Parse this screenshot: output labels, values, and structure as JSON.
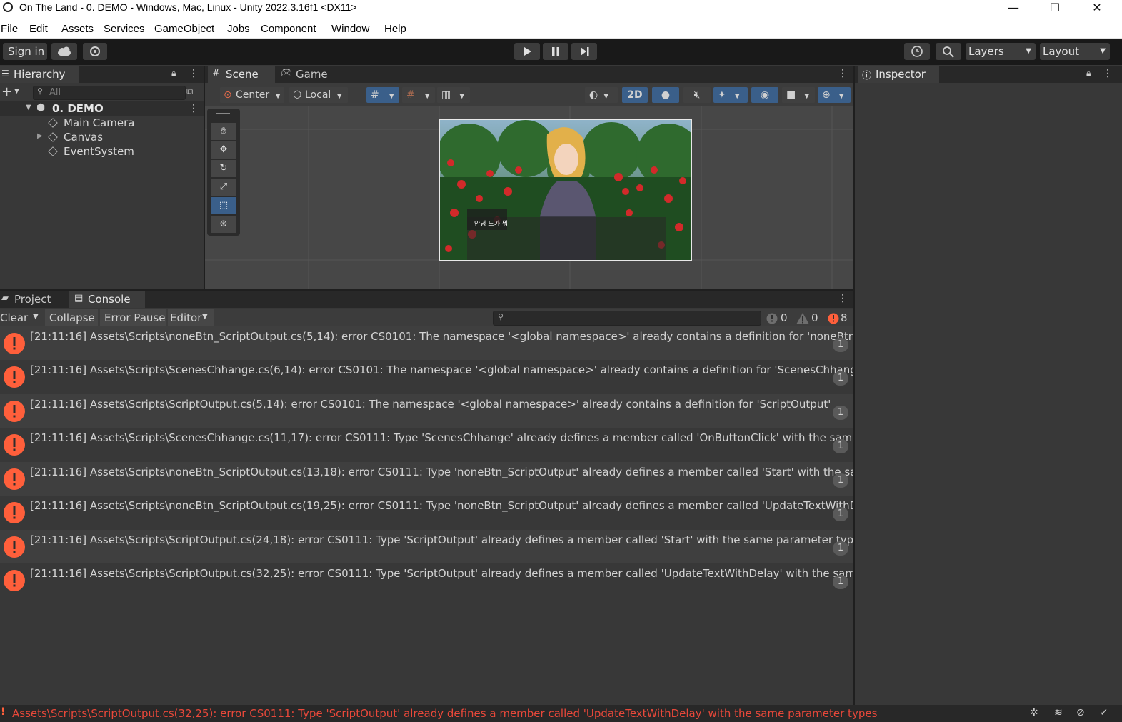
{
  "window": {
    "title": "On The Land - 0. DEMO - Windows, Mac, Linux - Unity 2022.3.16f1 <DX11>",
    "minimize": "—",
    "maximize": "☐",
    "close": "✕"
  },
  "menu": [
    "File",
    "Edit",
    "Assets",
    "Services",
    "GameObject",
    "Jobs",
    "Component",
    "Window",
    "Help"
  ],
  "toolbar": {
    "sign_in": "Sign in",
    "layers": "Layers",
    "layout": "Layout"
  },
  "hierarchy": {
    "tab": "Hierarchy",
    "search_placeholder": "All",
    "scene": "0. DEMO",
    "items": [
      "Main Camera",
      "Canvas",
      "EventSystem"
    ]
  },
  "scene_view": {
    "tab_scene": "Scene",
    "tab_game": "Game",
    "pivot": "Center",
    "space": "Local",
    "mode_2d": "2D",
    "dialogue_text": "안녕 느가 뭐"
  },
  "inspector": {
    "tab": "Inspector"
  },
  "console": {
    "tab_project": "Project",
    "tab_console": "Console",
    "clear": "Clear",
    "collapse": "Collapse",
    "error_pause": "Error Pause",
    "editor": "Editor",
    "log_count": "0",
    "warn_count": "0",
    "error_count": "8",
    "messages": [
      {
        "text": "[21:11:16] Assets\\Scripts\\noneBtn_ScriptOutput.cs(5,14): error CS0101: The namespace '<global namespace>' already contains a definition for 'noneBtn_ScriptOu",
        "count": "1"
      },
      {
        "text": "[21:11:16] Assets\\Scripts\\ScenesChhange.cs(6,14): error CS0101: The namespace '<global namespace>' already contains a definition for 'ScenesChhange'",
        "count": "1"
      },
      {
        "text": "[21:11:16] Assets\\Scripts\\ScriptOutput.cs(5,14): error CS0101: The namespace '<global namespace>' already contains a definition for 'ScriptOutput'",
        "count": "1"
      },
      {
        "text": "[21:11:16] Assets\\Scripts\\ScenesChhange.cs(11,17): error CS0111: Type 'ScenesChhange' already defines a member called 'OnButtonClick' with the same parame",
        "count": "1"
      },
      {
        "text": "[21:11:16] Assets\\Scripts\\noneBtn_ScriptOutput.cs(13,18): error CS0111: Type 'noneBtn_ScriptOutput' already defines a member called 'Start' with the same param",
        "count": "1"
      },
      {
        "text": "[21:11:16] Assets\\Scripts\\noneBtn_ScriptOutput.cs(19,25): error CS0111: Type 'noneBtn_ScriptOutput' already defines a member called 'UpdateTextWithDelay' with",
        "count": "1"
      },
      {
        "text": "[21:11:16] Assets\\Scripts\\ScriptOutput.cs(24,18): error CS0111: Type 'ScriptOutput' already defines a member called 'Start' with the same parameter types",
        "count": "1"
      },
      {
        "text": "[21:11:16] Assets\\Scripts\\ScriptOutput.cs(32,25): error CS0111: Type 'ScriptOutput' already defines a member called 'UpdateTextWithDelay' with the same parame",
        "count": "1"
      }
    ]
  },
  "status_bar": {
    "message": "Assets\\Scripts\\ScriptOutput.cs(32,25): error CS0111: Type 'ScriptOutput' already defines a member called 'UpdateTextWithDelay' with the same parameter types"
  },
  "colors": {
    "error": "#ff5f3b",
    "status_error_text": "#e8483a",
    "accent_blue": "#3a5f8a"
  }
}
